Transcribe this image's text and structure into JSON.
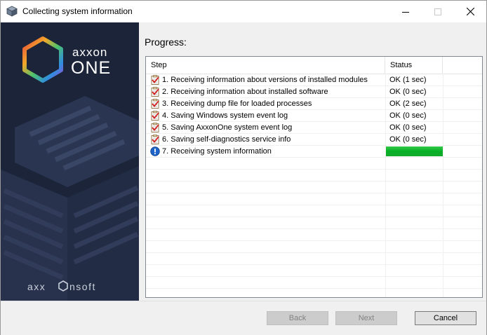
{
  "window": {
    "title": "Collecting system information",
    "icon": "package-icon"
  },
  "sidebar": {
    "brand_word_top": "axxon",
    "brand_word_bottom": "ONE",
    "company_left": "axx",
    "company_right": "nsoft"
  },
  "main": {
    "heading": "Progress:",
    "columns": {
      "step": "Step",
      "status": "Status"
    },
    "rows": [
      {
        "icon": "checklist-icon",
        "step": "1. Receiving information about versions of installed modules",
        "status": "OK (1 sec)"
      },
      {
        "icon": "checklist-icon",
        "step": "2. Receiving information about installed software",
        "status": "OK (0 sec)"
      },
      {
        "icon": "checklist-icon",
        "step": "3. Receiving dump file for loaded processes",
        "status": "OK (2 sec)"
      },
      {
        "icon": "checklist-icon",
        "step": "4. Saving Windows system event log",
        "status": "OK (0 sec)"
      },
      {
        "icon": "checklist-icon",
        "step": "5. Saving AxxonOne system event log",
        "status": "OK (0 sec)"
      },
      {
        "icon": "checklist-icon",
        "step": "6. Saving self-diagnostics service info",
        "status": "OK (0 sec)"
      },
      {
        "icon": "info-icon",
        "step": "7. Receiving system information",
        "status": "",
        "progress": 1.0
      }
    ]
  },
  "footer": {
    "back_label": "Back",
    "next_label": "Next",
    "cancel_label": "Cancel"
  },
  "colors": {
    "sidebar_bg": "#1b2438",
    "progress_fill": "#06b025"
  }
}
